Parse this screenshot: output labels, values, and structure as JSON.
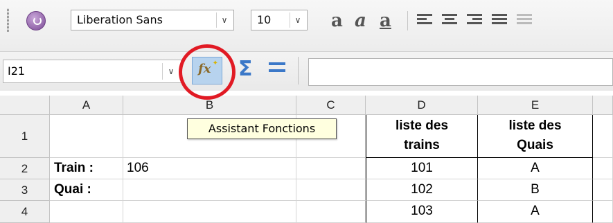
{
  "toolbar": {
    "font_name": "Liberation Sans",
    "font_size": "10",
    "format_icons": [
      "bold-a-icon",
      "italic-a-icon",
      "underline-a-icon"
    ],
    "align_icons": [
      "align-left-icon",
      "align-center-icon",
      "align-right-icon",
      "justify-icon",
      "wrap-icon"
    ]
  },
  "formula_bar": {
    "name_box": "I21",
    "function_wizard_icon": "fx-icon",
    "sum_icon": "sigma-icon",
    "formula_icon": "equals-icon",
    "formula_value": ""
  },
  "tooltip": "Assistant Fonctions",
  "grid": {
    "columns": [
      "A",
      "B",
      "C",
      "D",
      "E"
    ],
    "rows": [
      "1",
      "2",
      "3",
      "4"
    ],
    "cells": {
      "D1": "liste des trains",
      "E1": "liste des Quais",
      "A2": "Train :",
      "B2": "106",
      "D2": "101",
      "E2": "A",
      "A3": "Quai :",
      "D3": "102",
      "E3": "B",
      "D4": "103",
      "E4": "A"
    }
  },
  "colors": {
    "highlight_ring": "#e11a24",
    "tooltip_bg": "#ffffdf",
    "active_button": "#b7d3ee"
  }
}
